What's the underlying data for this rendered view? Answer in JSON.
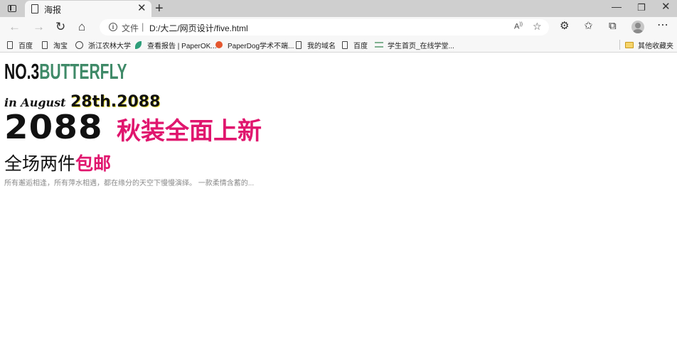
{
  "browser": {
    "tab": {
      "title": "海报"
    },
    "address": {
      "scheme_label": "文件",
      "separator": "|",
      "url": "D:/大二/网页设计/five.html"
    },
    "favorites": [
      {
        "label": "百度",
        "icon": "page-icon"
      },
      {
        "label": "淘宝",
        "icon": "page-icon"
      },
      {
        "label": "浙江农林大学",
        "icon": "globe-icon"
      },
      {
        "label": "查看报告 | PaperOK...",
        "icon": "leaf-icon"
      },
      {
        "label": "PaperDog学术不端...",
        "icon": "dog-icon"
      },
      {
        "label": "我的域名",
        "icon": "page-icon"
      },
      {
        "label": "百度",
        "icon": "page-icon"
      },
      {
        "label": "学生首页_在线学堂...",
        "icon": "lines-icon"
      }
    ],
    "other_favorites": "其他收藏夹"
  },
  "poster": {
    "brand_no": "NO.3",
    "brand_name": "BUTTERFLY",
    "date_prefix": "in August",
    "date_main": "28th.2088",
    "year": "2088",
    "headline": "秋装全面上新",
    "promo_plain": "全场两件",
    "promo_highlight": "包邮",
    "description": "所有邂逅相逢，所有萍水相遇，都在缘分的天空下慢慢演绎。 一款柔情含蓄的..."
  },
  "colors": {
    "brand_green": "#3f8a68",
    "accent_pink": "#e0166e",
    "date_shadow_yellow": "#e9e040"
  }
}
